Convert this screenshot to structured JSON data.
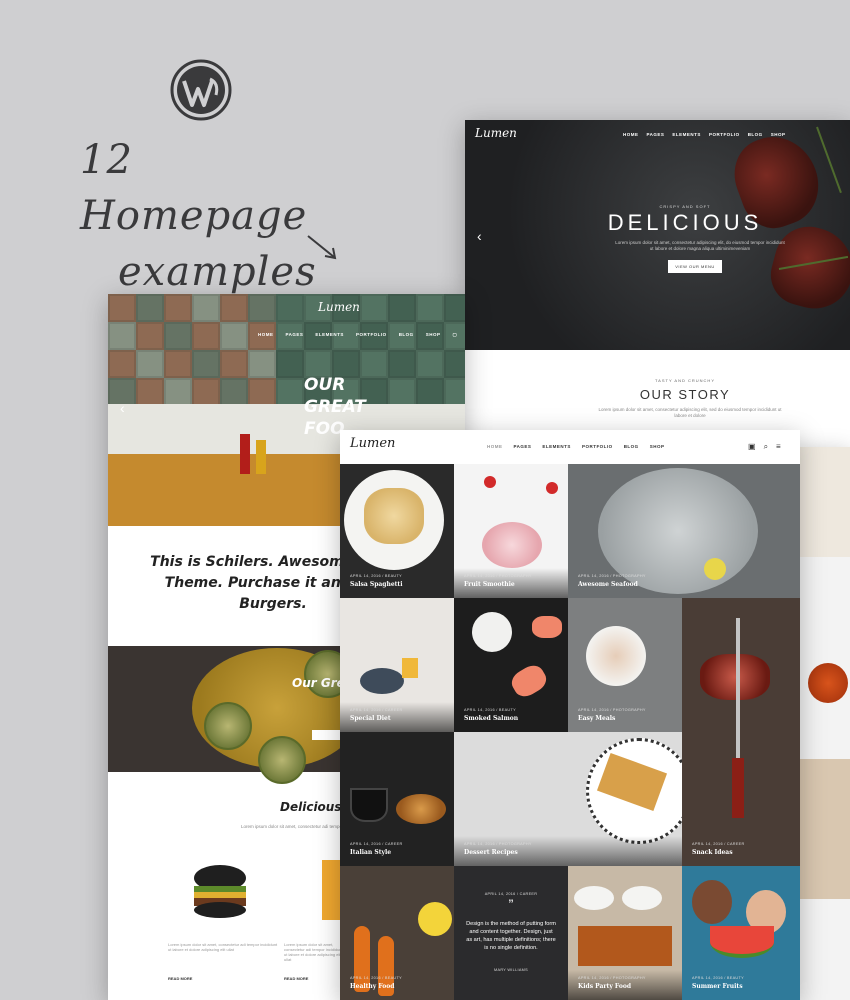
{
  "promo": {
    "headline_line1": "12 Homepage",
    "headline_line2": "examples"
  },
  "demo_back": {
    "nav": [
      "HOME",
      "PAGES",
      "ELEMENTS",
      "PORTFOLIO",
      "BLOG",
      "SHOP"
    ],
    "tagline": "CRISPY AND SOFT",
    "title": "DELICIOUS",
    "subtitle": "Lorem ipsum dolor sit amet, consectetur adipiscing elit, do eiusmod tempor incididunt ut labore et dolore magna aliqua ultiminimeveniam",
    "button": "VIEW OUR MENU",
    "story_tag": "TASTY AND CRUNCHY",
    "story_title": "OUR STORY",
    "story_text": "Lorem ipsum dolor sit amet, consectetur adipiscing elit, sed do eiusmod tempor incididunt ut labore et dolore"
  },
  "demo_mid": {
    "nav": [
      "HOME",
      "PAGES",
      "ELEMENTS",
      "PORTFOLIO",
      "BLOG",
      "SHOP"
    ],
    "hero_text": "OUR GREAT FOO",
    "quote": "This is Schilers. Awesome Food Theme. Purchase it and eat Burgers.",
    "section2_title": "Our Gre",
    "section3_title": "Delicious F",
    "section3_text": "Lorem ipsum dolor sit amet, consectetur adi tempor incididunt ut labore et dolore adipiscing elit ullat",
    "read_more": "READ MORE"
  },
  "demo_front": {
    "nav": [
      "HOME",
      "PAGES",
      "ELEMENTS",
      "PORTFOLIO",
      "BLOG",
      "SHOP"
    ],
    "posts": [
      {
        "date": "APRIL 14, 2016 / BEAUTY",
        "title": "Salsa Spaghetti"
      },
      {
        "date": "APRIL 14, 2016 / PHOTOGRAPHY",
        "title": "Fruit Smoothie"
      },
      {
        "date": "APRIL 14, 2016 / PHOTOGRAPHY",
        "title": "Awesome Seafood"
      },
      {
        "date": "APRIL 14, 2016 / CAREER",
        "title": "Special Diet"
      },
      {
        "date": "APRIL 14, 2016 / BEAUTY",
        "title": "Smoked Salmon"
      },
      {
        "date": "APRIL 14, 2016 / PHOTOGRAPHY",
        "title": "Easy Meals"
      },
      {
        "date": "APRIL 14, 2016 / CAREER",
        "title": "Italian Style"
      },
      {
        "date": "APRIL 14, 2016 / PHOTOGRAPHY",
        "title": "Dessert Recipes"
      },
      {
        "date": "APRIL 14, 2016 / CAREER",
        "title": "Snack Ideas"
      },
      {
        "date": "APRIL 14, 2016 / BEAUTY",
        "title": "Healthy Food"
      },
      {
        "date": "APRIL 14, 2016 / PHOTOGRAPHY",
        "title": "Kids Party Food"
      },
      {
        "date": "APRIL 14, 2016 / BEAUTY",
        "title": "Summer Fruits"
      }
    ],
    "quote_post": {
      "date": "APRIL 14, 2016 / CAREER",
      "text": "Design is the method of putting form and content together. Design, just as art, has multiple definitions; there is no single definition.",
      "author": "MARY WILLIAMS"
    }
  },
  "colors": {
    "background": "#cfcfd1",
    "dark": "#2b2b2d"
  }
}
